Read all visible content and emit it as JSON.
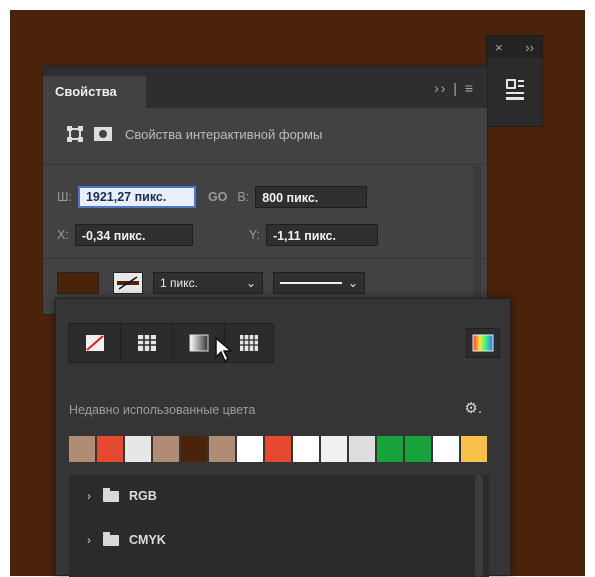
{
  "mini_panel": {
    "close_label": "×",
    "expand_label": "››",
    "tool_icon": "properties-panel-icon"
  },
  "panel": {
    "title": "Свойства",
    "header_controls": "›› | ≡",
    "shape_title": "Свойства интерактивной формы",
    "width_label": "Ш:",
    "width_value": "1921,27 пикс.",
    "link_label": "GO",
    "height_label": "В:",
    "height_value": "800 пикс.",
    "x_label": "X:",
    "x_value": "-0,34 пикс.",
    "y_label": "Y:",
    "y_value": "-1,11 пикс.",
    "stroke_width": "1 пикс.",
    "fill_color": "#4b230b"
  },
  "popup": {
    "tabs": [
      "no-color",
      "solid-color",
      "gradient",
      "pattern"
    ],
    "recent_label": "Недавно использованные цвета",
    "gear": "⚙.",
    "recent_colors": [
      "#b08c74",
      "#e34a2f",
      "#e7e7e7",
      "#b08c74",
      "#4b230b",
      "#b08c74",
      "#ffffff",
      "#e34a2f",
      "#ffffff",
      "#f0f0f0",
      "#dedede",
      "#18a23b",
      "#18a23b",
      "#ffffff",
      "#f7c14a"
    ],
    "folders": [
      "RGB",
      "CMYK"
    ]
  }
}
